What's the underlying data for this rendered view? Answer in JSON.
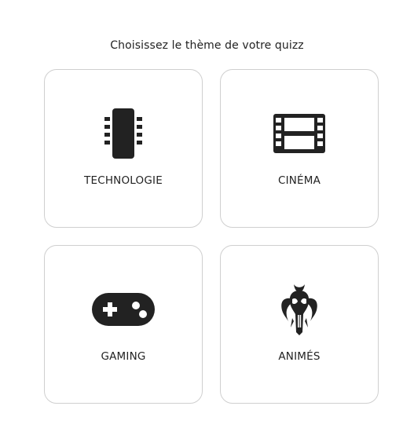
{
  "heading": "Choisissez le thème de votre quizz",
  "themes": [
    {
      "label": "TECHNOLOGIE",
      "icon": "microchip-icon"
    },
    {
      "label": "CINÉMA",
      "icon": "film-icon"
    },
    {
      "label": "GAMING",
      "icon": "gamepad-icon"
    },
    {
      "label": "ANIMÉS",
      "icon": "mandalorian-icon"
    }
  ],
  "colors": {
    "icon": "#222222",
    "card_border": "#cfcfcf",
    "text": "#222222"
  }
}
